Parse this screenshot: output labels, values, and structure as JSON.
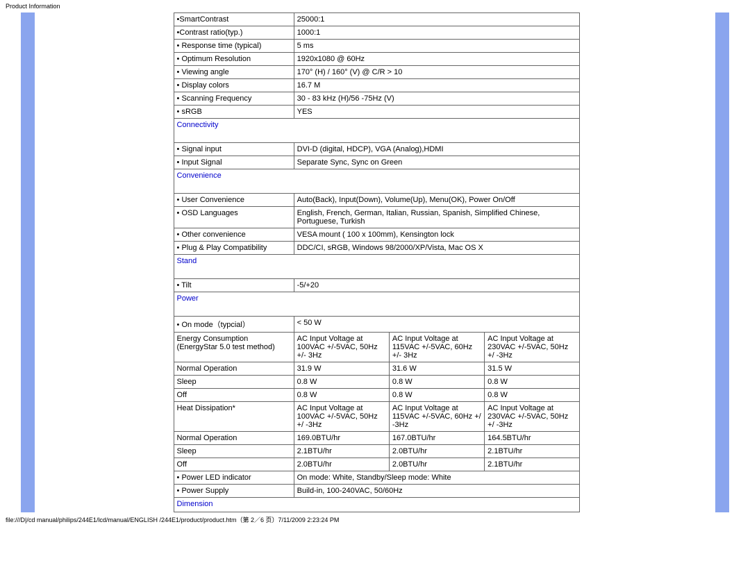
{
  "page_header": "Product Information",
  "page_footer": "file:///D|/cd manual/philips/244E1/lcd/manual/ENGLISH /244E1/product/product.htm（第 2／6 页）7/11/2009 2:23:24 PM",
  "specs_top": [
    {
      "label": "•SmartContrast",
      "value": "25000:1"
    },
    {
      "label": "•Contrast ratio(typ.)",
      "value": "1000:1"
    },
    {
      "label": "• Response time (typical)",
      "value": "5 ms"
    },
    {
      "label": "• Optimum Resolution",
      "value": "1920x1080 @ 60Hz"
    },
    {
      "label": "• Viewing angle",
      "value": "170° (H) / 160° (V) @ C/R > 10"
    },
    {
      "label": "• Display colors",
      "value": "16.7 M"
    },
    {
      "label": "• Scanning Frequency",
      "value": "30 - 83 kHz (H)/56 -75Hz (V)"
    },
    {
      "label": "• sRGB",
      "value": "   YES"
    }
  ],
  "connectivity": {
    "header": "Connectivity",
    "rows": [
      {
        "label": "• Signal input",
        "value": "DVI-D (digital, HDCP), VGA (Analog),HDMI"
      },
      {
        "label": "• Input Signal",
        "value": "Separate Sync, Sync on Green"
      }
    ]
  },
  "convenience": {
    "header": "Convenience",
    "rows": [
      {
        "label": "• User Convenience",
        "value": "Auto(Back), Input(Down), Volume(Up), Menu(OK), Power On/Off"
      },
      {
        "label": "• OSD Languages",
        "value": "English, French, German, Italian, Russian, Spanish, Simplified Chinese, Portuguese, Turkish"
      },
      {
        "label": "• Other convenience",
        "value": "VESA mount ( 100 x 100mm), Kensington lock"
      },
      {
        "label": "• Plug & Play Compatibility",
        "value": "DDC/CI, sRGB, Windows 98/2000/XP/Vista, Mac OS X"
      }
    ]
  },
  "stand": {
    "header": "Stand",
    "rows": [
      {
        "label": "• Tilt",
        "value": "-5/+20"
      }
    ]
  },
  "power": {
    "header": "Power",
    "on_mode": {
      "label": "• On mode（typcial）",
      "value": "< 50 W"
    },
    "energy_consumption": {
      "label": "Energy Consumption (EnergyStar 5.0 test method)",
      "c1": "AC Input Voltage at 100VAC +/-5VAC, 50Hz +/- 3Hz",
      "c2": "AC Input Voltage at 115VAC +/-5VAC, 60Hz +/- 3Hz",
      "c3": "AC Input Voltage at 230VAC +/-5VAC, 50Hz +/ -3Hz"
    },
    "normal_op": {
      "label": "Normal Operation",
      "c1": "31.9 W",
      "c2": "31.6 W",
      "c3": "31.5 W"
    },
    "sleep": {
      "label": "Sleep",
      "c1": "0.8 W",
      "c2": "0.8 W",
      "c3": "0.8 W"
    },
    "off": {
      "label": "Off",
      "c1": "0.8 W",
      "c2": "0.8 W",
      "c3": "0.8 W"
    },
    "heat_dissipation": {
      "label": "Heat Dissipation*",
      "c1": "AC Input Voltage at 100VAC +/-5VAC, 50Hz +/ -3Hz",
      "c2": "AC Input Voltage at 115VAC +/-5VAC, 60Hz +/ -3Hz",
      "c3": "AC Input Voltage at 230VAC +/-5VAC, 50Hz +/ -3Hz"
    },
    "hd_normal_op": {
      "label": "Normal Operation",
      "c1": "169.0BTU/hr",
      "c2": "167.0BTU/hr",
      "c3": "164.5BTU/hr"
    },
    "hd_sleep": {
      "label": "Sleep",
      "c1": "2.1BTU/hr",
      "c2": "2.0BTU/hr",
      "c3": "2.1BTU/hr"
    },
    "hd_off": {
      "label": "Off",
      "c1": "2.0BTU/hr",
      "c2": "2.0BTU/hr",
      "c3": "2.1BTU/hr"
    },
    "led": {
      "label": "• Power LED indicator",
      "value": "On mode: White, Standby/Sleep mode: White"
    },
    "supply": {
      "label": "• Power Supply",
      "value": "Build-in, 100-240VAC, 50/60Hz"
    }
  },
  "dimension": {
    "header": "Dimension"
  }
}
